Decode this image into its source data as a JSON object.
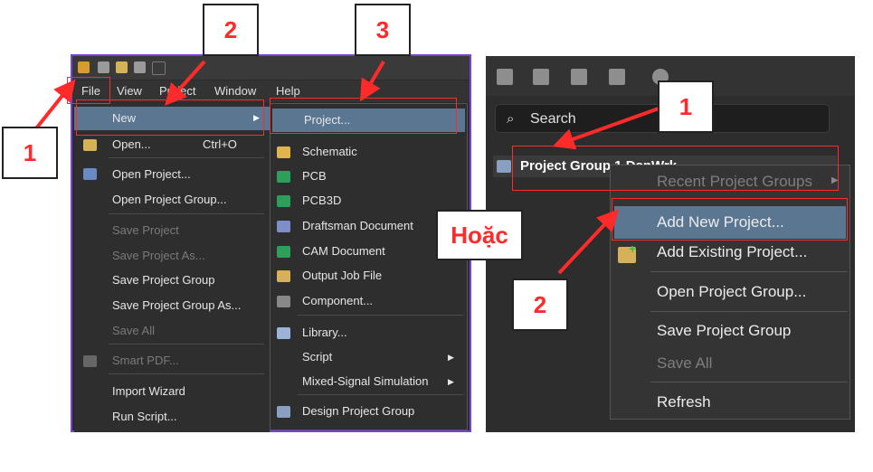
{
  "left": {
    "menubar": [
      "File",
      "View",
      "Project",
      "Window",
      "Help"
    ],
    "file_menu": {
      "new": "New",
      "open": "Open...",
      "open_shortcut": "Ctrl+O",
      "open_project": "Open Project...",
      "open_project_group": "Open Project Group...",
      "save_project": "Save Project",
      "save_project_as": "Save Project As...",
      "save_project_group": "Save Project Group",
      "save_project_group_as": "Save Project Group As...",
      "save_all": "Save All",
      "smart_pdf": "Smart PDF...",
      "import_wizard": "Import Wizard",
      "run_script": "Run Script..."
    },
    "new_submenu": {
      "project": "Project...",
      "schematic": "Schematic",
      "pcb": "PCB",
      "pcb3d": "PCB3D",
      "draftsman": "Draftsman Document",
      "cam": "CAM Document",
      "output_job": "Output Job File",
      "component": "Component...",
      "library": "Library...",
      "script": "Script",
      "mixed_signal": "Mixed-Signal Simulation",
      "design_project_group": "Design Project Group"
    }
  },
  "right": {
    "search_label": "Search",
    "tree_item": "Project Group 1.DsnWrk",
    "context_menu": {
      "recent": "Recent Project Groups",
      "add_new": "Add New Project...",
      "add_existing": "Add Existing Project...",
      "open_group": "Open Project Group...",
      "save_group": "Save Project Group",
      "save_all": "Save All",
      "refresh": "Refresh"
    }
  },
  "annotations": {
    "step1": "1",
    "step2": "2",
    "step3": "3",
    "right_step1": "1",
    "right_step2": "2",
    "or_label": "Hoặc"
  },
  "colors": {
    "highlight": "#5b7691",
    "annotation_red": "#ff2a2a",
    "panel_border": "#7b3fe0"
  }
}
